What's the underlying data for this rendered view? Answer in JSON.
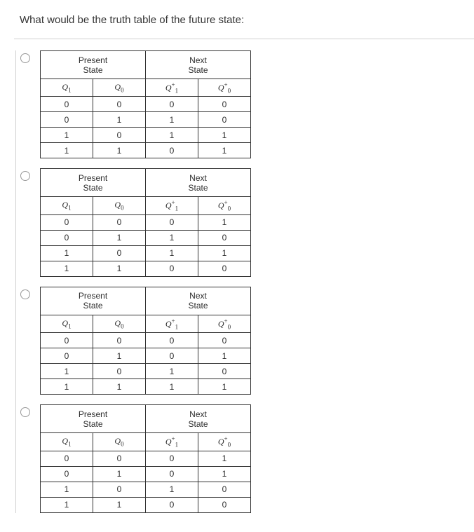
{
  "question": "What would be the truth table of the future state:",
  "headers": {
    "present": "Present State",
    "next": "Next State",
    "q1": "Q1",
    "q0": "Q0",
    "q1p": "Q1+",
    "q0p": "Q0+"
  },
  "options": [
    {
      "rows": [
        {
          "q1": "0",
          "q0": "0",
          "q1p": "0",
          "q0p": "0"
        },
        {
          "q1": "0",
          "q0": "1",
          "q1p": "1",
          "q0p": "0"
        },
        {
          "q1": "1",
          "q0": "0",
          "q1p": "1",
          "q0p": "1"
        },
        {
          "q1": "1",
          "q0": "1",
          "q1p": "0",
          "q0p": "1"
        }
      ]
    },
    {
      "rows": [
        {
          "q1": "0",
          "q0": "0",
          "q1p": "0",
          "q0p": "1"
        },
        {
          "q1": "0",
          "q0": "1",
          "q1p": "1",
          "q0p": "0"
        },
        {
          "q1": "1",
          "q0": "0",
          "q1p": "1",
          "q0p": "1"
        },
        {
          "q1": "1",
          "q0": "1",
          "q1p": "0",
          "q0p": "0"
        }
      ]
    },
    {
      "rows": [
        {
          "q1": "0",
          "q0": "0",
          "q1p": "0",
          "q0p": "0"
        },
        {
          "q1": "0",
          "q0": "1",
          "q1p": "0",
          "q0p": "1"
        },
        {
          "q1": "1",
          "q0": "0",
          "q1p": "1",
          "q0p": "0"
        },
        {
          "q1": "1",
          "q0": "1",
          "q1p": "1",
          "q0p": "1"
        }
      ]
    },
    {
      "rows": [
        {
          "q1": "0",
          "q0": "0",
          "q1p": "0",
          "q0p": "1"
        },
        {
          "q1": "0",
          "q0": "1",
          "q1p": "0",
          "q0p": "1"
        },
        {
          "q1": "1",
          "q0": "0",
          "q1p": "1",
          "q0p": "0"
        },
        {
          "q1": "1",
          "q0": "1",
          "q1p": "0",
          "q0p": "0"
        }
      ]
    }
  ]
}
